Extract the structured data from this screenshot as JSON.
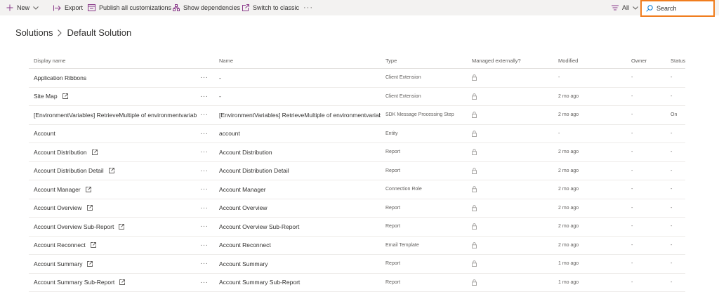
{
  "toolbar": {
    "new_label": "New",
    "export_label": "Export",
    "publish_label": "Publish all customizations",
    "dependencies_label": "Show dependencies",
    "classic_label": "Switch to classic",
    "more_label": "···",
    "filter_label": "All",
    "search_placeholder": "Search",
    "accent_color": "#8a3a8a",
    "highlight_color": "#f07d1e"
  },
  "breadcrumb": {
    "parent": "Solutions",
    "current": "Default Solution"
  },
  "table": {
    "columns": {
      "display_name": "Display name",
      "name": "Name",
      "type": "Type",
      "managed": "Managed externally?",
      "modified": "Modified",
      "owner": "Owner",
      "status": "Status"
    },
    "more_label": "···",
    "rows": [
      {
        "display": "Application Ribbons",
        "name": "-",
        "type": "Client Extension",
        "modified": "-",
        "owner": "-",
        "status": "-",
        "ext": false
      },
      {
        "display": "Site Map",
        "name": "-",
        "type": "Client Extension",
        "modified": "2 mo ago",
        "owner": "-",
        "status": "-",
        "ext": true
      },
      {
        "display": "[EnvironmentVariables] RetrieveMultiple of environmentvariab",
        "name": "[EnvironmentVariables] RetrieveMultiple of environmentvariab",
        "type": "SDK Message Processing Step",
        "modified": "2 mo ago",
        "owner": "-",
        "status": "On",
        "ext": false
      },
      {
        "display": "Account",
        "name": "account",
        "type": "Entity",
        "modified": "-",
        "owner": "-",
        "status": "-",
        "ext": false
      },
      {
        "display": "Account Distribution",
        "name": "Account Distribution",
        "type": "Report",
        "modified": "2 mo ago",
        "owner": "-",
        "status": "-",
        "ext": true
      },
      {
        "display": "Account Distribution Detail",
        "name": "Account Distribution Detail",
        "type": "Report",
        "modified": "2 mo ago",
        "owner": "-",
        "status": "-",
        "ext": true
      },
      {
        "display": "Account Manager",
        "name": "Account Manager",
        "type": "Connection Role",
        "modified": "2 mo ago",
        "owner": "-",
        "status": "-",
        "ext": true
      },
      {
        "display": "Account Overview",
        "name": "Account Overview",
        "type": "Report",
        "modified": "2 mo ago",
        "owner": "-",
        "status": "-",
        "ext": true
      },
      {
        "display": "Account Overview Sub-Report",
        "name": "Account Overview Sub-Report",
        "type": "Report",
        "modified": "2 mo ago",
        "owner": "-",
        "status": "-",
        "ext": true
      },
      {
        "display": "Account Reconnect",
        "name": "Account Reconnect",
        "type": "Email Template",
        "modified": "2 mo ago",
        "owner": "-",
        "status": "-",
        "ext": true
      },
      {
        "display": "Account Summary",
        "name": "Account Summary",
        "type": "Report",
        "modified": "1 mo ago",
        "owner": "-",
        "status": "-",
        "ext": true
      },
      {
        "display": "Account Summary Sub-Report",
        "name": "Account Summary Sub-Report",
        "type": "Report",
        "modified": "1 mo ago",
        "owner": "-",
        "status": "-",
        "ext": true
      }
    ]
  }
}
